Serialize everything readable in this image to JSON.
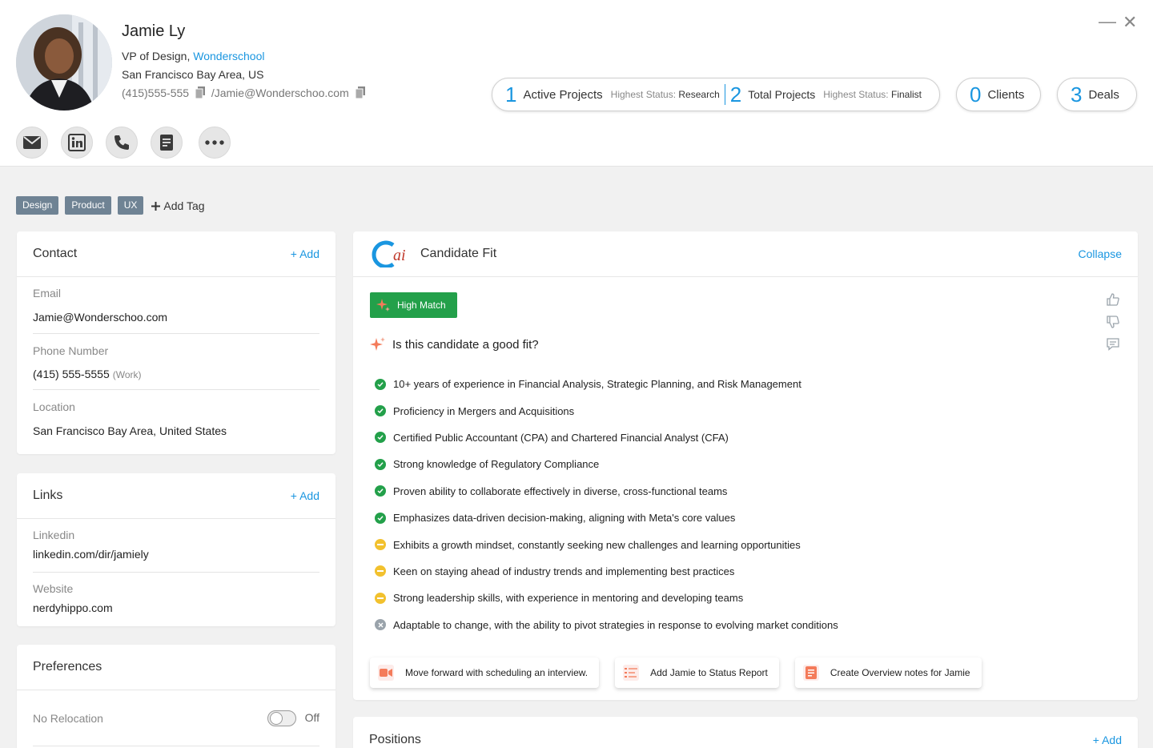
{
  "profile": {
    "name": "Jamie Ly",
    "title_prefix": "VP of Design, ",
    "company": "Wonderschool",
    "location": "San Francisco Bay Area, US",
    "phone": "(415)555-555",
    "email": "/Jamie@Wonderschoo.com"
  },
  "actions": [
    {
      "icon": "mail-icon"
    },
    {
      "icon": "linkedin-icon"
    },
    {
      "icon": "phone-icon"
    },
    {
      "icon": "notes-icon"
    },
    {
      "icon": "more-icon"
    }
  ],
  "window": {
    "minimize": "—",
    "close": "✕"
  },
  "stats": {
    "active_projects": {
      "count": "1",
      "label": "Active Projects",
      "status_label": "Highest Status:",
      "status": "Research"
    },
    "total_projects": {
      "count": "2",
      "label": "Total Projects",
      "status_label": "Highest Status:",
      "status": "Finalist"
    },
    "clients": {
      "count": "0",
      "label": "Clients"
    },
    "deals": {
      "count": "3",
      "label": "Deals"
    }
  },
  "tags": [
    "Design",
    "Product",
    "UX"
  ],
  "add_tag_label": "Add Tag",
  "contact": {
    "title": "Contact",
    "add_label": "+ Add",
    "email_label": "Email",
    "email": "Jamie@Wonderschoo.com",
    "phone_label": "Phone Number",
    "phone": "(415) 555-5555",
    "phone_type": "(Work)",
    "location_label": "Location",
    "location": "San Francisco Bay Area, United States"
  },
  "links": {
    "title": "Links",
    "add_label": "+ Add",
    "linkedin_label": "Linkedin",
    "linkedin": "linkedin.com/dir/jamiely",
    "website_label": "Website",
    "website": "nerdyhippo.com"
  },
  "preferences": {
    "title": "Preferences",
    "relocation_label": "No Relocation",
    "relocation_state": "Off"
  },
  "fit": {
    "logo_text": "ai",
    "title": "Candidate Fit",
    "collapse_label": "Collapse",
    "match_label": "High Match",
    "question": "Is this candidate a good fit?",
    "criteria": [
      {
        "text": "10+ years of experience in Financial Analysis, Strategic Planning, and Risk Management",
        "status": "met"
      },
      {
        "text": "Proficiency in Mergers and Acquisitions",
        "status": "met"
      },
      {
        "text": "Certified Public Accountant (CPA) and Chartered Financial Analyst (CFA)",
        "status": "met"
      },
      {
        "text": "Strong knowledge of Regulatory Compliance",
        "status": "met"
      },
      {
        "text": "Proven ability to collaborate effectively in diverse, cross-functional teams",
        "status": "met"
      },
      {
        "text": "Emphasizes data-driven decision-making, aligning with Meta's core values",
        "status": "met"
      },
      {
        "text": "Exhibits a growth mindset, constantly seeking new challenges and learning opportunities",
        "status": "partial"
      },
      {
        "text": "Keen on staying ahead of industry trends and implementing best practices",
        "status": "partial"
      },
      {
        "text": "Strong leadership skills, with experience in mentoring and developing teams",
        "status": "partial"
      },
      {
        "text": "Adaptable to change, with the ability to pivot strategies in response to evolving market conditions",
        "status": "none"
      }
    ],
    "suggestions": [
      {
        "text": "Move forward with scheduling an interview.",
        "icon": "video-icon"
      },
      {
        "text": "Add Jamie to Status Report",
        "icon": "report-icon"
      },
      {
        "text": "Create Overview notes for Jamie",
        "icon": "document-icon"
      }
    ]
  },
  "positions": {
    "title": "Positions",
    "add_label": "+ Add"
  },
  "colors": {
    "accent": "#1a96e0",
    "match": "#23a04a",
    "partial": "#f2c12e",
    "none": "#9aa3ab",
    "tag": "#6f8394"
  }
}
